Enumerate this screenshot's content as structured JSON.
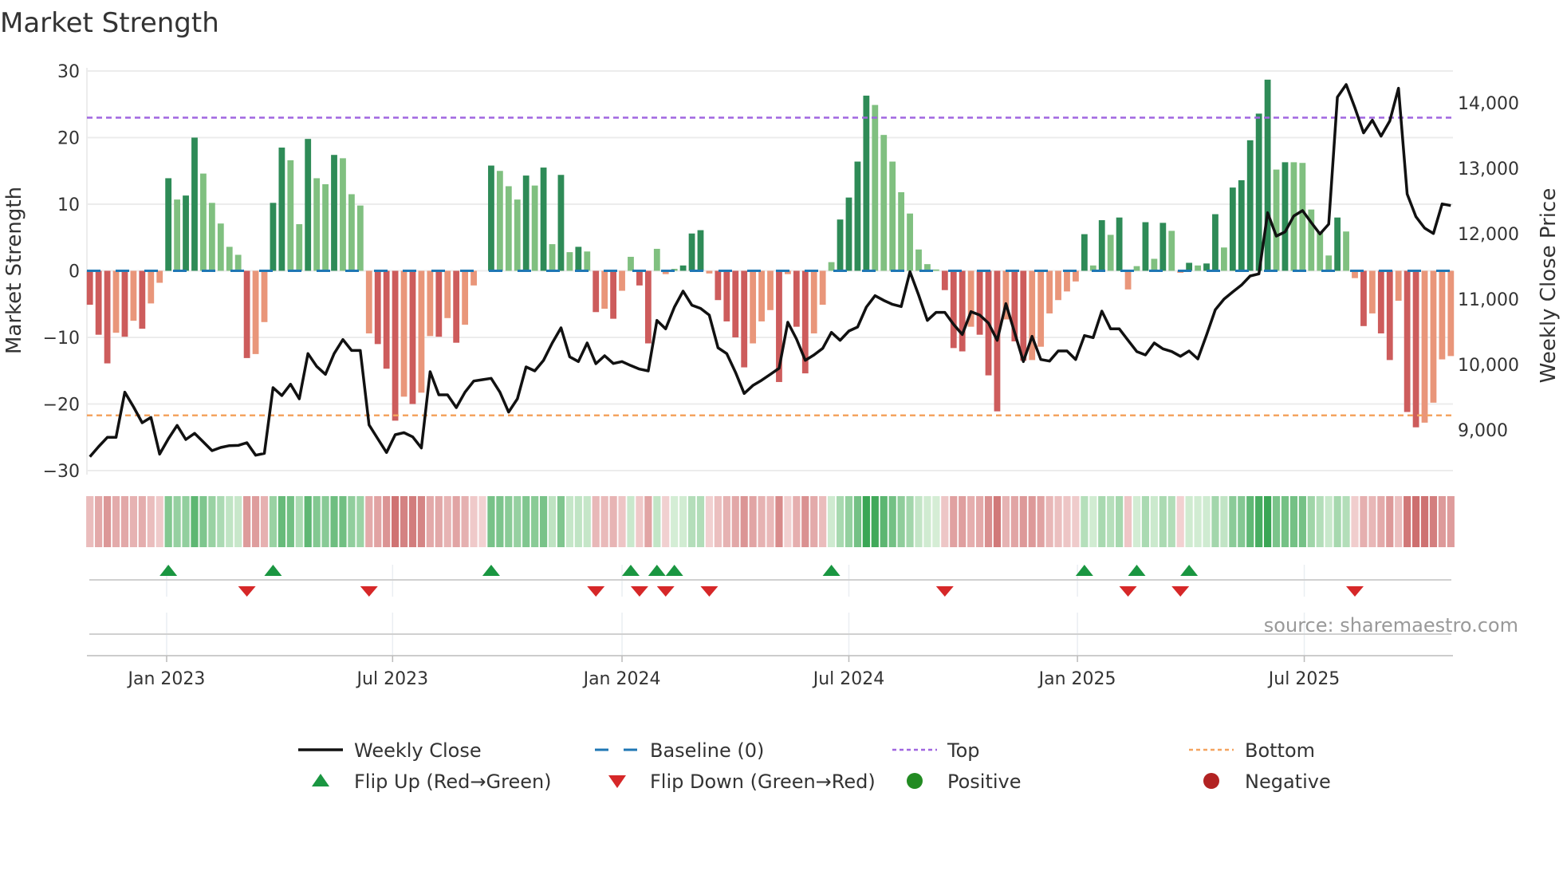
{
  "chart_data": {
    "type": "bar",
    "title": "Market Strength",
    "ylabel": "Market Strength",
    "y2label": "Weekly Close Price",
    "ylim": [
      -30,
      30
    ],
    "y2lim": [
      8286,
      14488
    ],
    "yticks": [
      "30",
      "20",
      "10",
      "0",
      "−10",
      "−20",
      "−30"
    ],
    "yticks_values": [
      30,
      20,
      10,
      0,
      -10,
      -20,
      -30
    ],
    "y2ticks": [
      "14,000",
      "13,000",
      "12,000",
      "11,000",
      "10,000",
      "9,000"
    ],
    "y2ticks_values": [
      14000,
      13000,
      12000,
      11000,
      10000,
      9000
    ],
    "xticks": [
      "Jan 2023",
      "Jul 2023",
      "Jan 2024",
      "Jul 2024",
      "Jan 2025",
      "Jul 2025"
    ],
    "xticks_week_index": [
      8.8,
      34.7,
      61.0,
      87.0,
      113.2,
      139.2
    ],
    "grid": true,
    "top_level": 23,
    "bottom_level": -21.7,
    "baseline": 0,
    "strength": [
      -5.1,
      -9.6,
      -13.9,
      -9.3,
      -9.9,
      -7.5,
      -8.7,
      -4.9,
      -1.8,
      13.9,
      10.7,
      11.3,
      20,
      14.6,
      10.2,
      7.1,
      3.6,
      2.4,
      -13.1,
      -12.5,
      -7.7,
      10.2,
      18.5,
      16.6,
      7.0,
      19.8,
      13.9,
      13.0,
      17.4,
      16.9,
      11.5,
      9.8,
      -9.4,
      -11.0,
      -14.7,
      -22.5,
      -18.9,
      -20.0,
      -18.3,
      -9.8,
      -9.9,
      -7.1,
      -10.8,
      -8.1,
      -2.2,
      0,
      15.8,
      15.0,
      12.7,
      10.7,
      14.3,
      12.8,
      15.5,
      4.0,
      14.4,
      2.8,
      3.6,
      2.9,
      -6.2,
      -5.7,
      -7.2,
      -3.0,
      2.1,
      -2.2,
      -10.9,
      3.3,
      -0.5,
      0.3,
      0.8,
      5.6,
      6.1,
      -0.4,
      -4.4,
      -7.6,
      -10.0,
      -14.5,
      -10.9,
      -7.6,
      -5.9,
      -16.7,
      -0.5,
      -8.4,
      -15.4,
      -9.4,
      -5.1,
      1.3,
      7.7,
      11.0,
      16.4,
      26.3,
      24.9,
      20.4,
      16.4,
      11.8,
      8.6,
      3.2,
      1.0,
      0.2,
      -2.9,
      -11.6,
      -12.1,
      -8.4,
      -9.6,
      -15.7,
      -21.1,
      -7.3,
      -10.6,
      -13.5,
      -13.4,
      -11.4,
      -6.4,
      -4.4,
      -3.1,
      -1.6,
      5.5,
      0.8,
      7.6,
      5.4,
      8.0,
      -2.8,
      0.7,
      7.3,
      1.8,
      7.2,
      6.0,
      -0.3,
      1.2,
      0.8,
      1.1,
      8.5,
      3.5,
      12.5,
      13.6,
      19.6,
      23.6,
      28.7,
      15.2,
      16.3,
      16.3,
      16.2,
      9.2,
      5.9,
      2.3,
      8.0,
      5.9,
      -1.1,
      -8.3,
      -6.4,
      -9.4,
      -13.4,
      -4.5,
      -21.2,
      -23.5,
      -22.8,
      -19.8,
      -13.3,
      -12.8
    ],
    "weekly_close": [
      8590,
      8744,
      8886,
      8886,
      9577,
      9354,
      9110,
      9191,
      8630,
      8866,
      9069,
      8854,
      8947,
      8817,
      8683,
      8732,
      8760,
      8764,
      8805,
      8614,
      8642,
      9646,
      9525,
      9699,
      9476,
      10167,
      9972,
      9850,
      10167,
      10382,
      10215,
      10215,
      9077,
      8866,
      8655,
      8927,
      8959,
      8894,
      8724,
      9890,
      9537,
      9537,
      9342,
      9577,
      9748,
      9768,
      9789,
      9577,
      9273,
      9476,
      9964,
      9903,
      10065,
      10329,
      10561,
      10118,
      10045,
      10329,
      10012,
      10134,
      10016,
      10045,
      9984,
      9931,
      9903,
      10675,
      10545,
      10878,
      11122,
      10907,
      10858,
      10756,
      10256,
      10167,
      9882,
      9557,
      9679,
      9760,
      9850,
      9943,
      10646,
      10390,
      10065,
      10146,
      10248,
      10492,
      10370,
      10512,
      10573,
      10878,
      11053,
      10980,
      10919,
      10886,
      11419,
      11061,
      10675,
      10797,
      10797,
      10614,
      10459,
      10809,
      10756,
      10634,
      10370,
      10931,
      10492,
      10045,
      10431,
      10077,
      10053,
      10207,
      10207,
      10077,
      10443,
      10411,
      10817,
      10545,
      10545,
      10370,
      10199,
      10146,
      10329,
      10240,
      10199,
      10126,
      10207,
      10085,
      10451,
      10838,
      11000,
      11110,
      11215,
      11354,
      11386,
      12321,
      11963,
      12028,
      12272,
      12354,
      12171,
      11996,
      12146,
      14089,
      14281,
      13927,
      13541,
      13736,
      13492,
      13724,
      14224,
      12606,
      12260,
      12085,
      12004,
      12455,
      12431
    ],
    "flip_up_week_index": [
      9,
      21,
      46,
      62,
      65,
      67,
      85,
      114,
      120,
      126
    ],
    "flip_down_week_index": [
      18,
      32,
      58,
      63,
      66,
      71,
      98,
      119,
      125,
      145
    ],
    "legend_position": "bottom",
    "legend": [
      {
        "label": "Weekly Close",
        "kind": "line"
      },
      {
        "label": "Baseline (0)",
        "kind": "dash"
      },
      {
        "label": "Top",
        "kind": "dot-purple"
      },
      {
        "label": "Bottom",
        "kind": "dot-orange"
      },
      {
        "label": "Flip Up (Red→Green)",
        "kind": "tri-up"
      },
      {
        "label": "Flip Down (Green→Red)",
        "kind": "tri-down"
      },
      {
        "label": "Positive",
        "kind": "dot-green"
      },
      {
        "label": "Negative",
        "kind": "dot-red"
      }
    ],
    "source": "source: sharemaestro.com",
    "colors": {
      "pos_strong": "#2e8b57",
      "pos_weak": "#80c080",
      "neg_strong": "#cd5c5c",
      "neg_weak": "#e9967a",
      "line": "#111111",
      "baseline": "#1f77b4",
      "top": "#a066e0",
      "bottom": "#f4a460",
      "flip_up": "#1a9641",
      "flip_down": "#d62728",
      "positive": "#228b22",
      "negative": "#b22222"
    }
  }
}
